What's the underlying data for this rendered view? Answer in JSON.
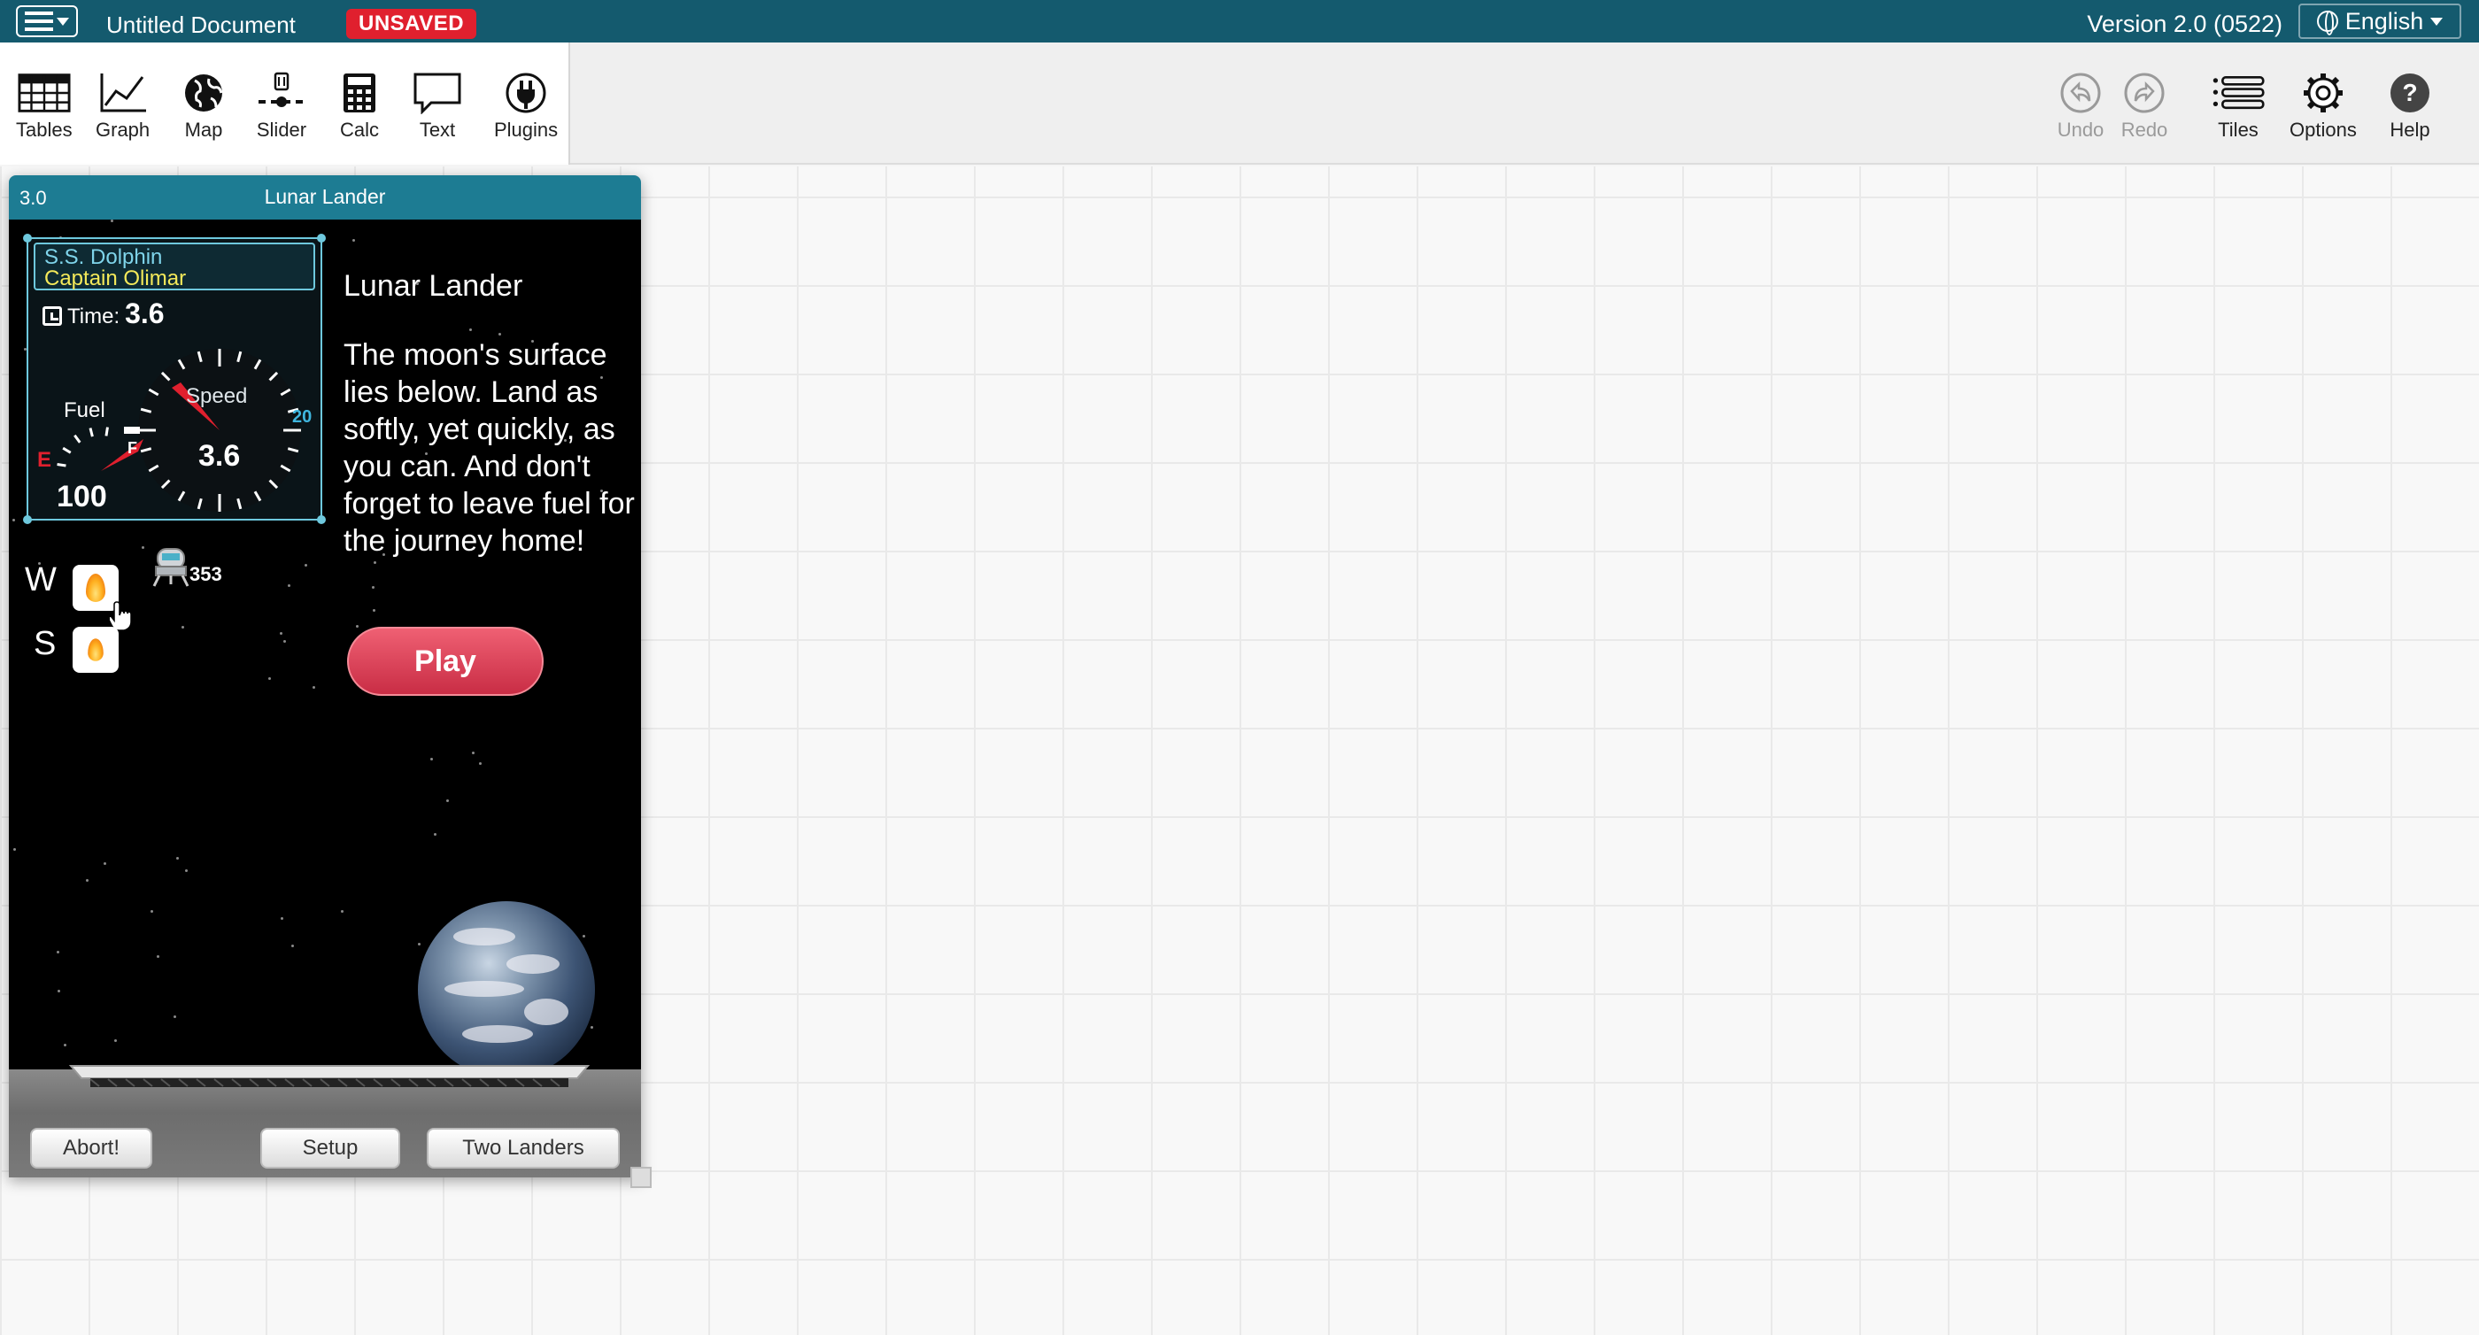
{
  "topbar": {
    "doc_title": "Untitled Document",
    "unsaved_badge": "UNSAVED",
    "version": "Version 2.0 (0522)",
    "language": "English"
  },
  "toolshelf": {
    "left": [
      {
        "label": "Tables",
        "icon": "table-icon"
      },
      {
        "label": "Graph",
        "icon": "graph-icon"
      },
      {
        "label": "Map",
        "icon": "globe-icon"
      },
      {
        "label": "Slider",
        "icon": "slider-icon"
      },
      {
        "label": "Calc",
        "icon": "calculator-icon"
      },
      {
        "label": "Text",
        "icon": "text-bubble-icon"
      },
      {
        "label": "Plugins",
        "icon": "plug-icon"
      }
    ],
    "right": [
      {
        "label": "Undo",
        "icon": "undo-icon"
      },
      {
        "label": "Redo",
        "icon": "redo-icon"
      },
      {
        "label": "Tiles",
        "icon": "tiles-list-icon"
      },
      {
        "label": "Options",
        "icon": "gear-icon"
      },
      {
        "label": "Help",
        "icon": "help-icon"
      }
    ]
  },
  "tile": {
    "version": "3.0",
    "title": "Lunar Lander"
  },
  "game": {
    "ship_name": "S.S. Dolphin",
    "captain": "Captain Olimar",
    "time_label": "Time:",
    "time_value": "3.6",
    "fuel_label": "Fuel",
    "fuel_value": "100",
    "fuel_empty_mark": "E",
    "speed_label": "Speed",
    "speed_value": "3.6",
    "speed_max": "20",
    "thrust_up_key": "W",
    "thrust_down_key": "S",
    "altitude": "353",
    "heading": "Lunar Lander",
    "instructions": "The moon's surface lies below. Land as softly, yet quickly, as you can. And don't forget to leave fuel for the journey home!",
    "play_label": "Play",
    "abort_label": "Abort!",
    "setup_label": "Setup",
    "two_landers_label": "Two Landers"
  },
  "colors": {
    "topbar": "#145a6e",
    "unsaved": "#e0202e",
    "tile_title": "#1d7c93",
    "play": "#d63b52",
    "hud_border": "#6ec8dd"
  }
}
